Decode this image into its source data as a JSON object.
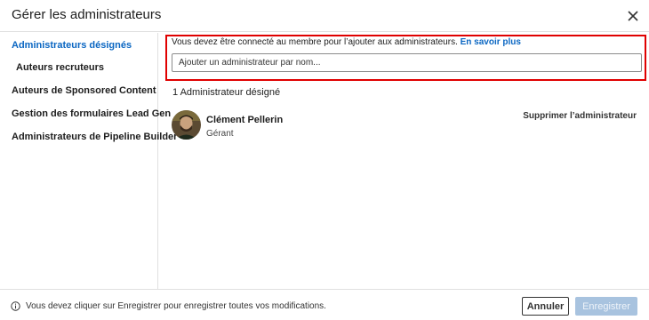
{
  "dialog": {
    "title": "Gérer les administrateurs",
    "close_icon": "close-icon"
  },
  "sidebar": {
    "items": [
      {
        "label": "Administrateurs désignés",
        "active": true,
        "sub": false
      },
      {
        "label": "Auteurs recruteurs",
        "active": false,
        "sub": true
      },
      {
        "label": "Auteurs de Sponsored Content",
        "active": false,
        "sub": false
      },
      {
        "label": "Gestion des formulaires Lead Gen",
        "active": false,
        "sub": false
      },
      {
        "label": "Administrateurs de Pipeline Builder",
        "active": false,
        "sub": false
      }
    ]
  },
  "main": {
    "info_text": "Vous devez être connecté au membre pour l’ajouter aux administrateurs.",
    "learn_more_label": "En savoir plus",
    "search_placeholder": "Ajouter un administrateur par nom...",
    "section_title": "1 Administrateur désigné",
    "admins": [
      {
        "name": "Clément Pellerin",
        "role": "Gérant",
        "action_label": "Supprimer l’administrateur"
      }
    ]
  },
  "footer": {
    "info_icon": "info-icon",
    "message": "Vous devez cliquer sur Enregistrer pour enregistrer toutes vos modifications.",
    "cancel_label": "Annuler",
    "save_label": "Enregistrer"
  },
  "colors": {
    "accent": "#0a66c2",
    "highlight_border": "#e00000",
    "save_disabled": "#a8c3df"
  }
}
